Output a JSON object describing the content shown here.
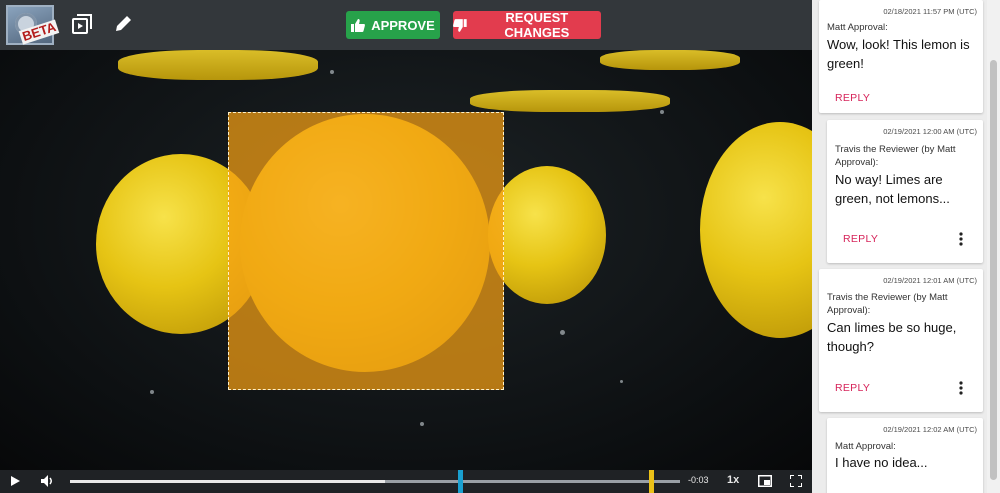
{
  "toolbar": {
    "logo_text": "BETA",
    "approve_label": "APPROVE",
    "request_changes_label": "REQUEST CHANGES",
    "approve_color": "#27a24a",
    "request_color": "#e23c4e"
  },
  "player": {
    "time_remaining": "-0:03",
    "speed": "1x",
    "progress": 0.517,
    "marker_in_color": "#1aa0d0",
    "marker_out_color": "#ebc118"
  },
  "annotation": {
    "color": "#f5a014"
  },
  "comments": [
    {
      "timestamp": "02/18/2021 11:57 PM (UTC)",
      "author": "Matt Approval:",
      "text": "Wow, look! This lemon is green!",
      "reply_label": "REPLY",
      "has_menu": false
    },
    {
      "timestamp": "02/19/2021 12:00 AM (UTC)",
      "author": "Travis the Reviewer (by Matt Approval):",
      "text": "No way! Limes are green, not lemons...",
      "reply_label": "REPLY",
      "has_menu": true
    },
    {
      "timestamp": "02/19/2021 12:01 AM (UTC)",
      "author": "Travis the Reviewer (by Matt Approval):",
      "text": "Can limes be so huge, though?",
      "reply_label": "REPLY",
      "has_menu": true
    },
    {
      "timestamp": "02/19/2021 12:02 AM (UTC)",
      "author": "Matt Approval:",
      "text": "I have no idea...",
      "reply_label": "REPLY",
      "has_menu": false
    }
  ]
}
